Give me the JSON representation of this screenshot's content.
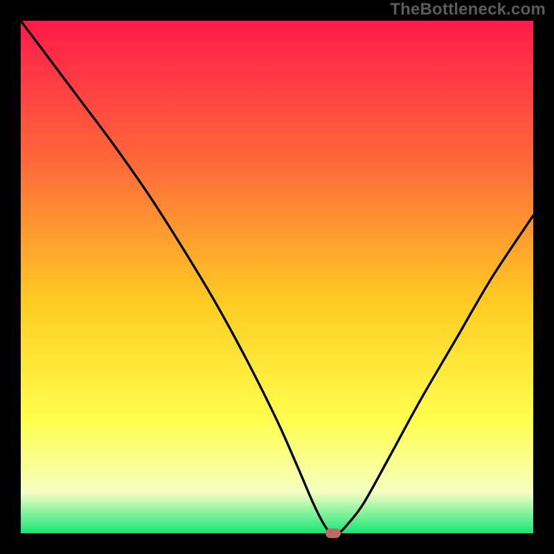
{
  "watermark": "TheBottleneck.com",
  "colors": {
    "background": "#000000",
    "curve": "#000000",
    "gradient_top": "#ff1a49",
    "gradient_mid1": "#ff6a3a",
    "gradient_mid2": "#ffcc22",
    "gradient_mid3": "#ffff4d",
    "gradient_pale": "#f5ffc2",
    "gradient_bottom": "#17e676",
    "marker": "#bd6a64"
  },
  "chart_data": {
    "type": "line",
    "title": "",
    "xlabel": "",
    "ylabel": "",
    "xlim": [
      0,
      100
    ],
    "ylim": [
      0,
      100
    ],
    "grid": false,
    "legend": false,
    "annotations": [],
    "series": [
      {
        "name": "bottleneck-curve",
        "x": [
          0,
          6,
          12,
          18,
          25,
          32,
          38,
          44,
          50,
          54,
          57,
          59,
          60.5,
          62,
          64,
          67,
          72,
          78,
          85,
          92,
          100
        ],
        "y": [
          100,
          92,
          84,
          76,
          66,
          55,
          45,
          34,
          22,
          13,
          6,
          2,
          0,
          0,
          2,
          6,
          15,
          26,
          38,
          50,
          62
        ]
      }
    ],
    "marker": {
      "x": 61,
      "y": 0,
      "color": "#bd6a64"
    }
  }
}
